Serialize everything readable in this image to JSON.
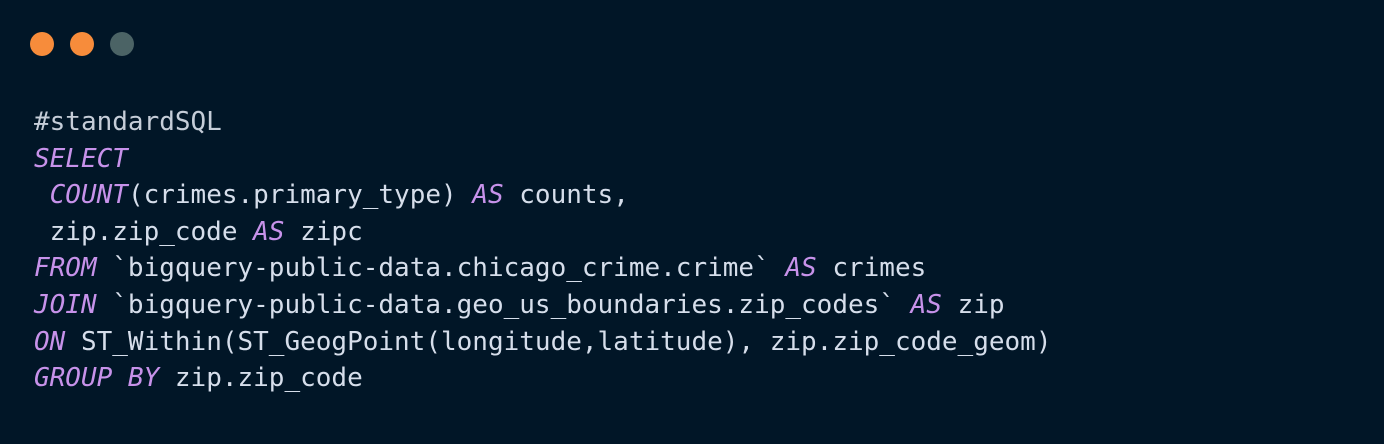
{
  "colors": {
    "background": "#011627",
    "text": "#d6deeb",
    "keyword": "#c792ea",
    "comment": "#c5cdd8"
  },
  "window_controls": [
    {
      "icon": "window-close-dot",
      "color": "#f78c3b"
    },
    {
      "icon": "window-minimize-dot",
      "color": "#f78c3b"
    },
    {
      "icon": "window-maximize-dot",
      "color": "#4b6365"
    }
  ],
  "code_lines": [
    [
      {
        "t": "#standardSQL",
        "k": "comment"
      }
    ],
    [
      {
        "t": "SELECT",
        "k": "kw"
      }
    ],
    [
      {
        "t": " ",
        "k": "txt"
      },
      {
        "t": "COUNT",
        "k": "kw"
      },
      {
        "t": "(crimes.primary_type) ",
        "k": "txt"
      },
      {
        "t": "AS",
        "k": "kw"
      },
      {
        "t": " counts,",
        "k": "txt"
      }
    ],
    [
      {
        "t": " zip.zip_code ",
        "k": "txt"
      },
      {
        "t": "AS",
        "k": "kw"
      },
      {
        "t": " zipc",
        "k": "txt"
      }
    ],
    [
      {
        "t": "FROM",
        "k": "kw"
      },
      {
        "t": " `bigquery-public-data.chicago_crime.crime` ",
        "k": "txt"
      },
      {
        "t": "AS",
        "k": "kw"
      },
      {
        "t": " crimes",
        "k": "txt"
      }
    ],
    [
      {
        "t": "JOIN",
        "k": "kw"
      },
      {
        "t": " `bigquery-public-data.geo_us_boundaries.zip_codes` ",
        "k": "txt"
      },
      {
        "t": "AS",
        "k": "kw"
      },
      {
        "t": " zip",
        "k": "txt"
      }
    ],
    [
      {
        "t": "ON",
        "k": "kw"
      },
      {
        "t": " ST_Within(ST_GeogPoint(longitude,latitude), zip.zip_code_geom)",
        "k": "txt"
      }
    ],
    [
      {
        "t": "GROUP BY",
        "k": "kw"
      },
      {
        "t": " zip.zip_code",
        "k": "txt"
      }
    ]
  ]
}
